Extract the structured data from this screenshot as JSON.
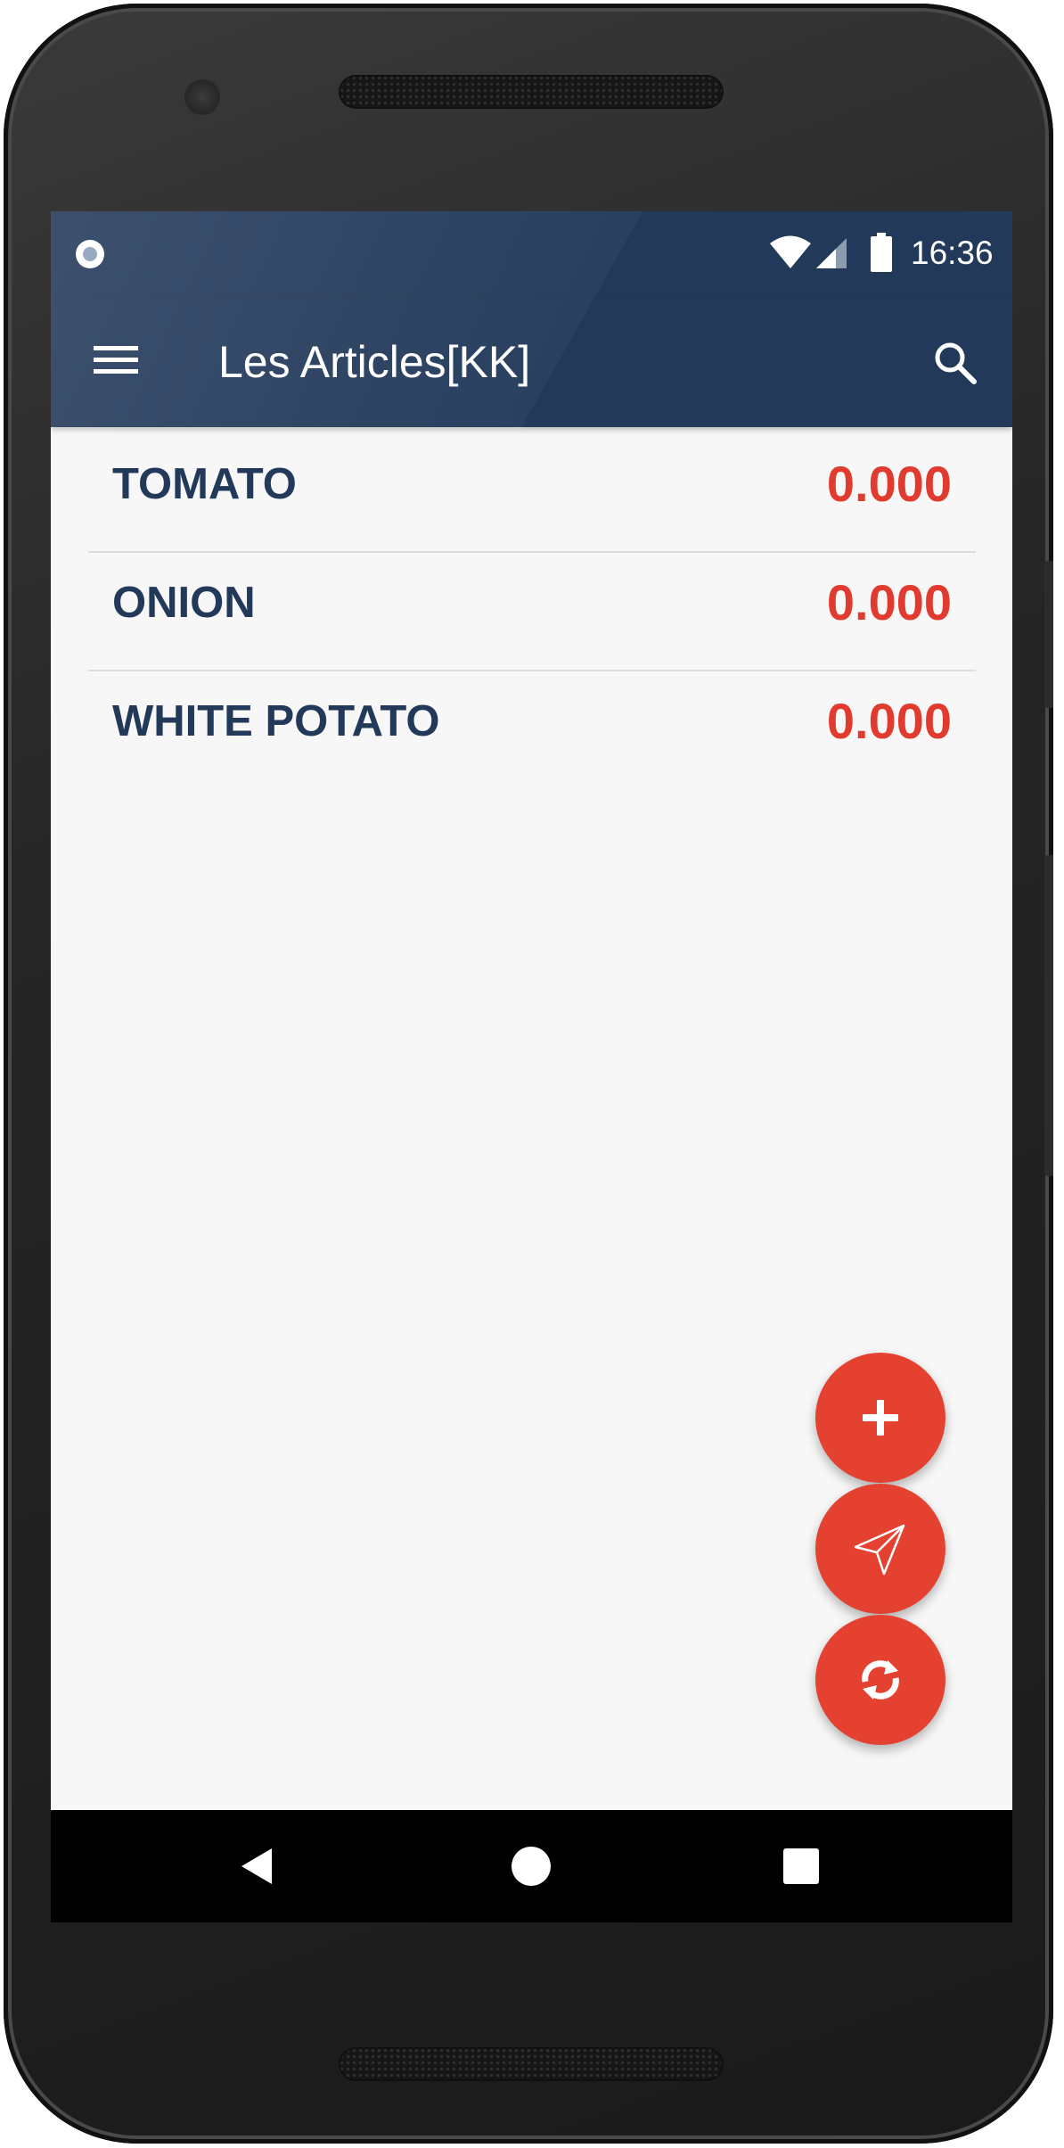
{
  "status_bar": {
    "time": "16:36",
    "icons": [
      "notification-icon",
      "wifi-icon",
      "signal-icon",
      "battery-icon"
    ]
  },
  "app_bar": {
    "title": "Les Articles[KK]",
    "menu_icon": "menu-icon",
    "search_icon": "search-icon"
  },
  "articles": [
    {
      "name": "TOMATO",
      "value": "0.000"
    },
    {
      "name": "ONION",
      "value": "0.000"
    },
    {
      "name": "WHITE POTATO",
      "value": "0.000"
    }
  ],
  "fabs": [
    {
      "icon": "plus-icon"
    },
    {
      "icon": "send-icon"
    },
    {
      "icon": "sync-icon"
    }
  ],
  "nav_bar": {
    "icons": [
      "back-icon",
      "home-icon",
      "recents-icon"
    ]
  },
  "colors": {
    "primary": "#22395a",
    "accent": "#e54131",
    "value_text": "#e13b2f",
    "background": "#f7f7f7",
    "divider": "#dcdcdc"
  }
}
